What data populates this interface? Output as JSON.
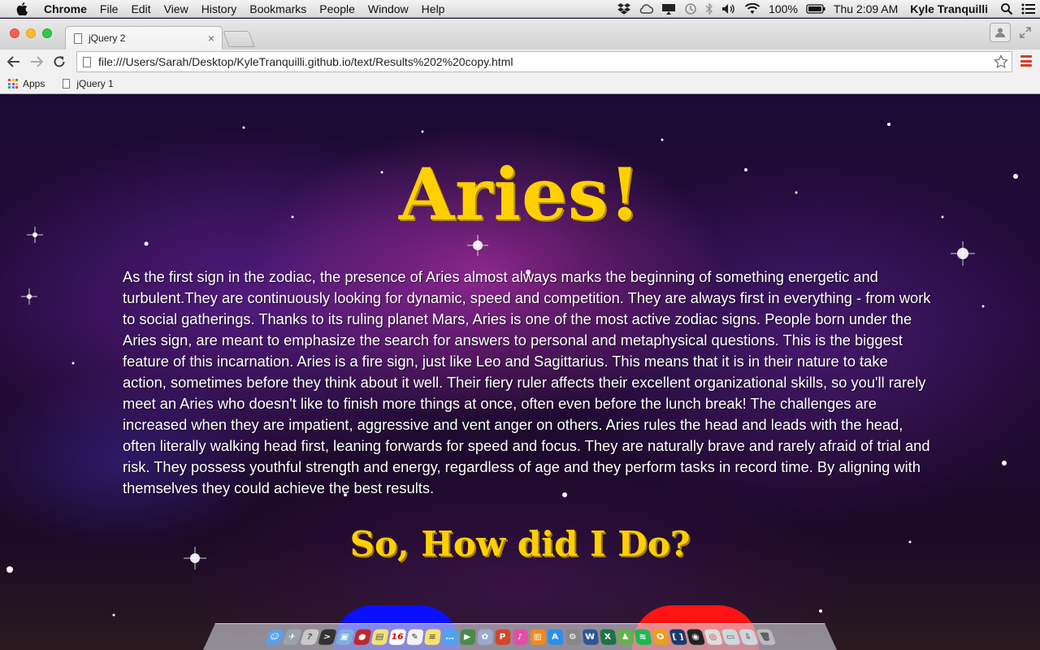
{
  "menubar": {
    "app_name": "Chrome",
    "items": [
      "File",
      "Edit",
      "View",
      "History",
      "Bookmarks",
      "People",
      "Window",
      "Help"
    ],
    "battery": "100%",
    "clock": "Thu 2:09 AM",
    "user": "Kyle Tranquilli"
  },
  "browser": {
    "tab_title": "jQuery 2",
    "url": "file:///Users/Sarah/Desktop/KyleTranquilli.github.io/text/Results%202%20copy.html",
    "bookmarks": [
      "Apps",
      "jQuery 1"
    ]
  },
  "page": {
    "title": "Aries!",
    "description": "As the first sign in the zodiac, the presence of Aries almost always marks the beginning of something energetic and turbulent.They are continuously looking for dynamic, speed and competition. They are always first in everything - from work to social gatherings. Thanks to its ruling planet Mars, Aries is one of the most active zodiac signs. People born under the Aries sign, are meant to emphasize the search for answers to personal and metaphysical questions. This is the biggest feature of this incarnation. Aries is a fire sign, just like Leo and Sagittarius. This means that it is in their nature to take action, sometimes before they think about it well. Their fiery ruler affects their excellent organizational skills, so you'll rarely meet an Aries who doesn't like to finish more things at once, often even before the lunch break! The challenges are increased when they are impatient, aggressive and vent anger on others. Aries rules the head and leads with the head, often literally walking head first, leaning forwards for speed and focus. They are naturally brave and rarely afraid of trial and risk. They possess youthful strength and energy, regardless of age and they perform tasks in record time. By aligning with themselves they could achieve the best results.",
    "question": "So, How did I Do?",
    "colors": {
      "title": "#ffd000",
      "left_button": "#0a10ff",
      "right_button": "#ff1414"
    }
  },
  "dock": {
    "icons": [
      "finder-icon",
      "launchpad-icon",
      "help-icon",
      "terminal-icon",
      "preview-icon",
      "photo-booth-icon",
      "stickies-icon",
      "calendar-icon",
      "textedit-icon",
      "notes-icon",
      "messages-icon",
      "facetime-icon",
      "photos-icon",
      "powerpoint-icon",
      "itunes-icon",
      "ibooks-icon",
      "app-store-icon",
      "system-preferences-icon",
      "word-icon",
      "excel-icon",
      "web-sharing-icon",
      "spotify-icon",
      "outlook-icon",
      "brackets-icon",
      "github-icon",
      "chrome-icon",
      "documents-folder-icon",
      "downloads-folder-icon",
      "trash-icon"
    ]
  }
}
